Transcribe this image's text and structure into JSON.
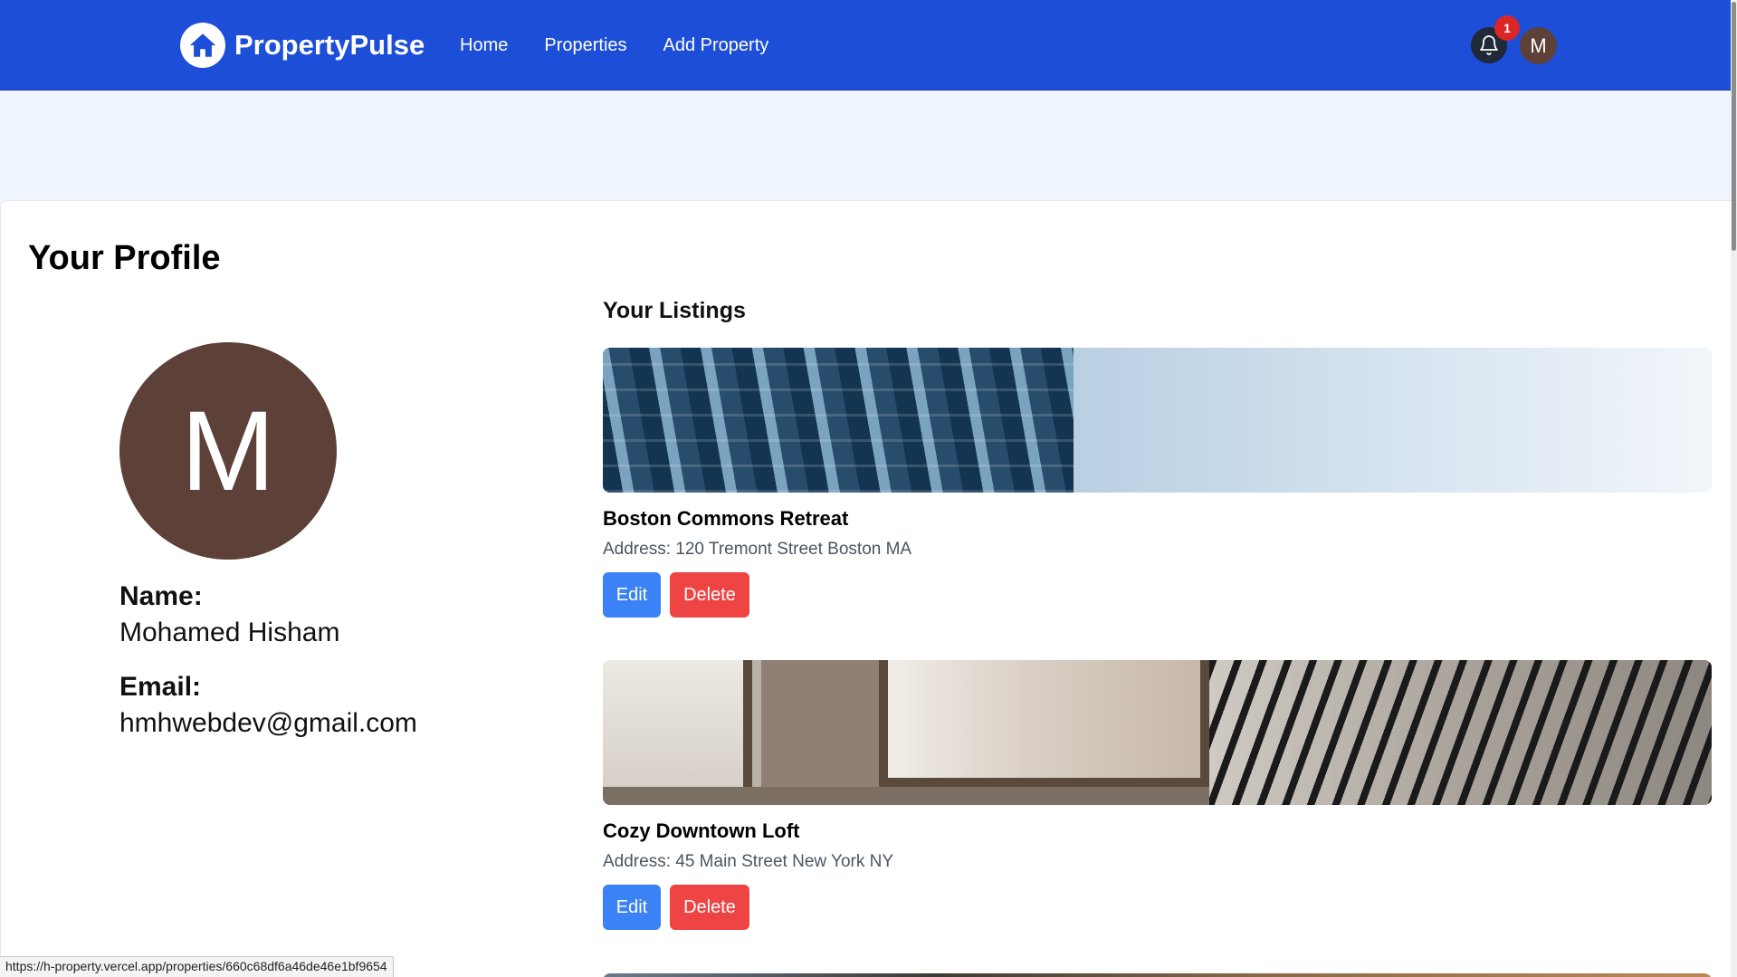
{
  "navbar": {
    "brand": "PropertyPulse",
    "links": [
      "Home",
      "Properties",
      "Add Property"
    ],
    "notification_count": "1",
    "avatar_initial": "M"
  },
  "profile": {
    "title": "Your Profile",
    "avatar_initial": "M",
    "name_label": "Name:",
    "name": "Mohamed Hisham",
    "email_label": "Email:",
    "email": "hmhwebdev@gmail.com"
  },
  "listings": {
    "title": "Your Listings",
    "items": [
      {
        "name": "Boston Commons Retreat",
        "address": "Address: 120 Tremont Street Boston MA",
        "edit_label": "Edit",
        "delete_label": "Delete"
      },
      {
        "name": "Cozy Downtown Loft",
        "address": "Address: 45 Main Street New York NY",
        "edit_label": "Edit",
        "delete_label": "Delete"
      }
    ]
  },
  "status_bar": {
    "url": "https://h-property.vercel.app/properties/660c68df6a46de46e1bf9654"
  },
  "colors": {
    "navbar": "#1d4ed8",
    "edit_button": "#3b82f6",
    "delete_button": "#ef4444",
    "avatar": "#5d4037",
    "badge": "#dc2626"
  }
}
